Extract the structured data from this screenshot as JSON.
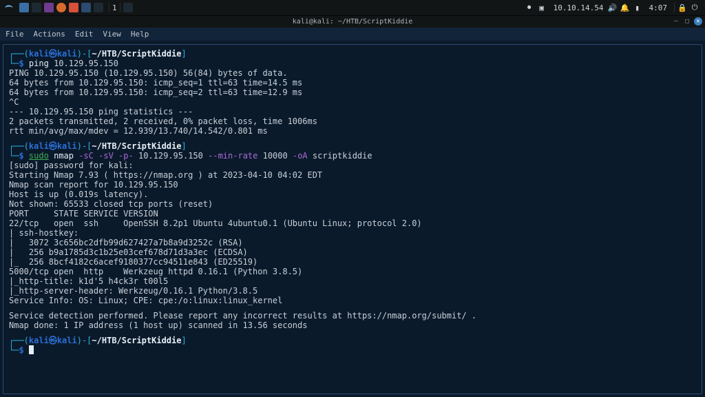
{
  "panel": {
    "digit": "1",
    "net_ip": "10.10.14.54",
    "clock": "4:07",
    "icons": {
      "kali": "kali-menu-icon",
      "fm": "file-manager-icon",
      "term": "terminal-icon",
      "editor": "editor-icon",
      "firefox": "firefox-icon",
      "burp": "burp-icon",
      "wireshark": "wireshark-icon",
      "workspace_left": "workspace-left-icon",
      "workspace_right": "workspace-right-icon",
      "net": "network-icon",
      "sound": "sound-icon",
      "bell": "notification-icon",
      "battery": "battery-icon",
      "lock": "lock-icon",
      "power": "power-icon",
      "rec": "record-icon"
    }
  },
  "titlebar": {
    "text": "kali@kali: ~/HTB/ScriptKiddie",
    "min": "—",
    "max": "□",
    "close": "✕"
  },
  "menubar": {
    "items": [
      "File",
      "Actions",
      "Edit",
      "View",
      "Help"
    ]
  },
  "prompt": {
    "p_open": "┌──(",
    "user": "kali",
    "at": "㉿",
    "host": "kali",
    "p_mid": ")-[",
    "cwd": "~/HTB/ScriptKiddie",
    "p_close": "]",
    "p2_open": "└─",
    "dollar": "$"
  },
  "cmd1": {
    "bin": "ping",
    "args": "10.129.95.150"
  },
  "ping": {
    "l1": "PING 10.129.95.150 (10.129.95.150) 56(84) bytes of data.",
    "l2": "64 bytes from 10.129.95.150: icmp_seq=1 ttl=63 time=14.5 ms",
    "l3": "64 bytes from 10.129.95.150: icmp_seq=2 ttl=63 time=12.9 ms",
    "l4": "^C",
    "l5": "--- 10.129.95.150 ping statistics ---",
    "l6": "2 packets transmitted, 2 received, 0% packet loss, time 1006ms",
    "l7": "rtt min/avg/max/mdev = 12.939/13.740/14.542/0.801 ms"
  },
  "cmd2": {
    "sudo": "sudo",
    "bin": "nmap",
    "f1": "-sC",
    "f2": "-sV",
    "f3": "-p-",
    "host": "10.129.95.150",
    "f4": "--min-rate",
    "rate": "10000",
    "f5": "-oA",
    "out": "scriptkiddie"
  },
  "nmap": {
    "l0": "[sudo] password for kali:",
    "l1": "Starting Nmap 7.93 ( https://nmap.org ) at 2023-04-10 04:02 EDT",
    "l2": "Nmap scan report for 10.129.95.150",
    "l3": "Host is up (0.019s latency).",
    "l4": "Not shown: 65533 closed tcp ports (reset)",
    "l5": "PORT     STATE SERVICE VERSION",
    "l6": "22/tcp   open  ssh     OpenSSH 8.2p1 Ubuntu 4ubuntu0.1 (Ubuntu Linux; protocol 2.0)",
    "l7": "| ssh-hostkey:",
    "l8": "|   3072 3c656bc2dfb99d627427a7b8a9d3252c (RSA)",
    "l9": "|   256 b9a1785d3c1b25e03cef678d71d3a3ec (ECDSA)",
    "l10": "|_  256 8bcf4182c6acef9180377cc94511e843 (ED25519)",
    "l11": "5000/tcp open  http    Werkzeug httpd 0.16.1 (Python 3.8.5)",
    "l12": "|_http-title: k1d'5 h4ck3r t00l5",
    "l13": "|_http-server-header: Werkzeug/0.16.1 Python/3.8.5",
    "l14": "Service Info: OS: Linux; CPE: cpe:/o:linux:linux_kernel",
    "l15": "Service detection performed. Please report any incorrect results at https://nmap.org/submit/ .",
    "l16": "Nmap done: 1 IP address (1 host up) scanned in 13.56 seconds"
  }
}
